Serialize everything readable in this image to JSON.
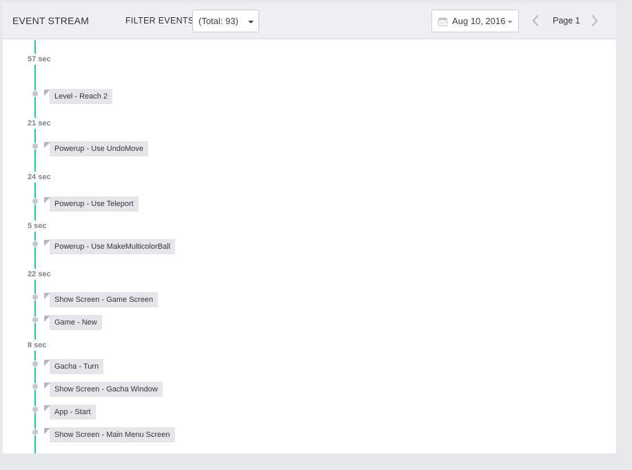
{
  "header": {
    "title": "EVENT STREAM",
    "filter_label": "FILTER EVENTS",
    "filter_value": "(Total: 93)",
    "date_value": "Aug 10, 2016",
    "page_label": "Page 1"
  },
  "icons": {
    "calendar": "calendar-icon",
    "filter_caret": "caret-down-icon",
    "date_caret": "caret-down-icon",
    "prev": "chevron-left-icon",
    "next": "chevron-right-icon"
  },
  "colors": {
    "timeline": "#1fc6a4",
    "tag_bg": "#e4e6e9",
    "dot": "#c4c8cd"
  },
  "stream": {
    "gaps": [
      "57 sec",
      "21 sec",
      "24 sec",
      "5 sec",
      "22 sec",
      "8 sec"
    ],
    "events": [
      "Level - Reach 2",
      "Powerup - Use UndoMove",
      "Powerup - Use Teleport",
      "Powerup - Use MakeMulticolorBall",
      "Show Screen - Game Screen",
      "Game - New",
      "Gacha - Turn",
      "Show Screen - Gacha Window",
      "App - Start",
      "Show Screen - Main Menu Screen"
    ]
  }
}
